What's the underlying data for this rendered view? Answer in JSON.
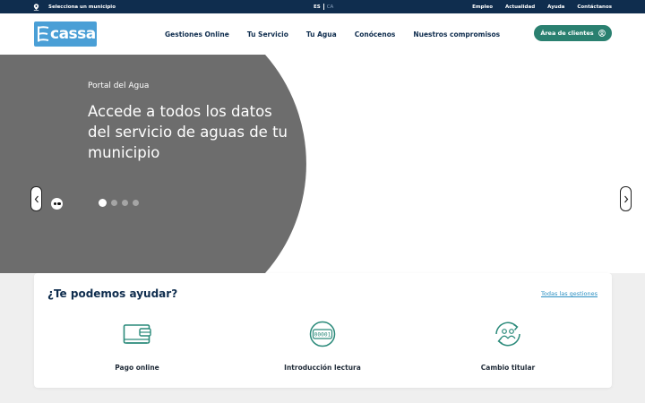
{
  "topbar": {
    "municipality_label": "Selecciona un municipio",
    "lang_active": "ES",
    "lang_inactive": "CA",
    "links": [
      "Empleo",
      "Actualidad",
      "Ayuda",
      "Contáctanos"
    ]
  },
  "header": {
    "logo_text": "cassa",
    "nav": [
      "Gestiones Online",
      "Tu Servicio",
      "Tu Agua",
      "Conócenos",
      "Nuestros compromisos"
    ],
    "client_button": "Área de clientes"
  },
  "hero": {
    "eyebrow": "Portal del Agua",
    "headline": "Accede a todos los datos del servicio de aguas de tu municipio",
    "slides_total": 4,
    "active_slide": 1
  },
  "help": {
    "title": "¿Te podemos ayudar?",
    "all_link": "Todas las gestiones",
    "services": [
      {
        "label": "Pago online",
        "icon": "wallet-icon"
      },
      {
        "label": "Introducción lectura",
        "icon": "meter-reading-icon",
        "icon_text": "00001"
      },
      {
        "label": "Cambio titular",
        "icon": "change-holder-icon"
      }
    ]
  },
  "colors": {
    "topbar": "#0f2d4e",
    "logo": "#4a9fd6",
    "accent_green": "#2a8070",
    "hero_gray": "#6d6d6d",
    "link_blue": "#2b8fc2",
    "section_bg": "#efefef"
  }
}
